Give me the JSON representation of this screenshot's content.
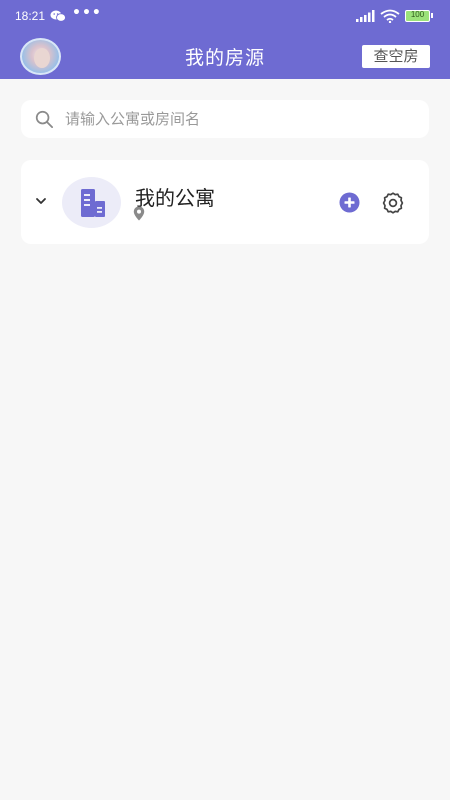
{
  "status_bar": {
    "time": "18:21",
    "more_indicator": "•••",
    "battery": "100",
    "icons": [
      "wechat-icon",
      "signal-icon",
      "wifi-icon",
      "battery-icon"
    ]
  },
  "header": {
    "title": "我的房源",
    "vacant_button": "查空房",
    "background_color": "#6e6bd2"
  },
  "search": {
    "placeholder": "请输入公寓或房间名",
    "value": ""
  },
  "apartments": [
    {
      "name": "我的公寓",
      "address": "",
      "icons": [
        "chevron-down-icon",
        "building-icon",
        "location-icon",
        "add-icon",
        "gear-icon"
      ]
    }
  ],
  "colors": {
    "accent": "#6e6bd2",
    "page_background": "#f7f7f7",
    "card_background": "#ffffff"
  }
}
